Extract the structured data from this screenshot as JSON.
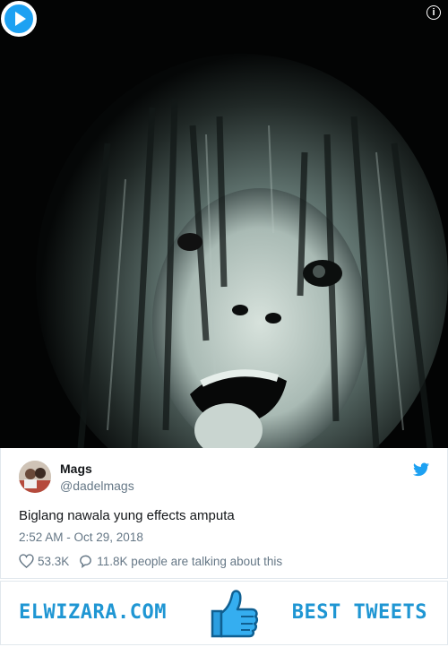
{
  "media": {
    "info_glyph": "i",
    "play_icon": "play-icon"
  },
  "tweet": {
    "name": "Mags",
    "handle": "@dadelmags",
    "text": "Biglang nawala yung effects amputa",
    "timestamp": "2:52 AM - Oct 29, 2018",
    "likes": "53.3K",
    "talking": "11.8K people are talking about this"
  },
  "banner": {
    "left_text": "ELWIZARA.COM",
    "right_text": "BEST TWEETS"
  },
  "colors": {
    "twitter_blue": "#1da1f2",
    "banner_blue": "#1f96d3",
    "text_primary": "#14171a",
    "text_secondary": "#657786"
  }
}
